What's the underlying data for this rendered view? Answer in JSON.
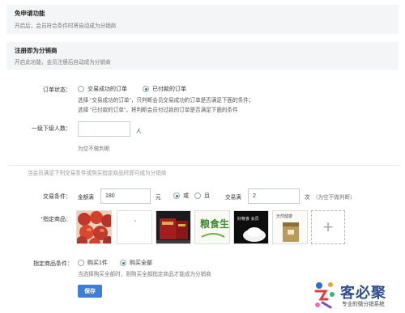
{
  "sections": [
    {
      "title": "免申请功能",
      "desc": "开启后，会员符合条件时将自动成为分销商"
    },
    {
      "title": "注册即为分销商",
      "desc": "开启此功能，会员注册后自动成为分销商"
    }
  ],
  "order_status": {
    "label": "订单状态：",
    "options": [
      "交易成功的订单",
      "已付款的订单"
    ],
    "selected_index": 1,
    "help_line1": "选择 \"交易成功的订单\"，只判断会员交易成功的订单是否满足下面的条件；",
    "help_line2": "选择 \"已付款的订单\"，将判断会员付过款的订单是否满足下面的条件"
  },
  "subordinates": {
    "label": "一级下级人数：",
    "value": "",
    "unit": "人",
    "hint": "为空不做判断"
  },
  "divider_text": "当会员满足下列交易条件或购买指定商品时即可成为分销商",
  "trade_condition": {
    "label": "交易条件：",
    "amount_label": "金额满",
    "amount_value": "180",
    "amount_unit": "元",
    "logic_options": [
      "或",
      "且"
    ],
    "logic_selected_index": 0,
    "count_label": "交易满",
    "count_value": "2",
    "count_unit": "次",
    "count_hint": "（为空不做判断）"
  },
  "products": {
    "label": "指定商品：",
    "required_mark": "*",
    "items": [
      {
        "icon": "apple-photo"
      },
      {
        "icon": "blank-product"
      },
      {
        "icon": "red-box-product"
      },
      {
        "icon": "green-tea-product",
        "text": "粮食生活"
      },
      {
        "icon": "rice-product",
        "text": "好粮食 会员"
      },
      {
        "icon": "gift-bag-product",
        "text": "天然健康"
      }
    ],
    "add_icon": "plus-icon"
  },
  "product_condition": {
    "label": "指定商品条件：",
    "options": [
      "购买1件",
      "购买全部"
    ],
    "selected_index": 1,
    "hint": "当选择购买全部时，则购买全部指定商品才能成为分销商"
  },
  "save_label": "保存",
  "brand": {
    "name": "客必聚",
    "tagline": "专业的微分销系统"
  },
  "colors": {
    "accent": "#3d7fd6",
    "brand": "#2f4f8f",
    "required": "#e23c3c"
  }
}
